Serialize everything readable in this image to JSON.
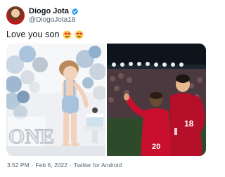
{
  "author": {
    "display_name": "Diogo Jota",
    "handle": "@DiogoJota18"
  },
  "tweet": {
    "text": "Love you son",
    "emojis": [
      "smiling-face-with-heart-eyes-emoji",
      "smiling-face-with-heart-eyes-emoji"
    ]
  },
  "media": {
    "photo1": {
      "sign_text": "ONE"
    },
    "photo2": {
      "jersey_numbers": [
        "20",
        "18"
      ]
    }
  },
  "footer": {
    "time": "3:52 PM",
    "separator": "·",
    "date": "Feb 6, 2022",
    "source": "Twitter for Android"
  },
  "colors": {
    "verified": "#1d9bf0",
    "secondary_text": "#536471",
    "kit_red": "#c8102e"
  }
}
